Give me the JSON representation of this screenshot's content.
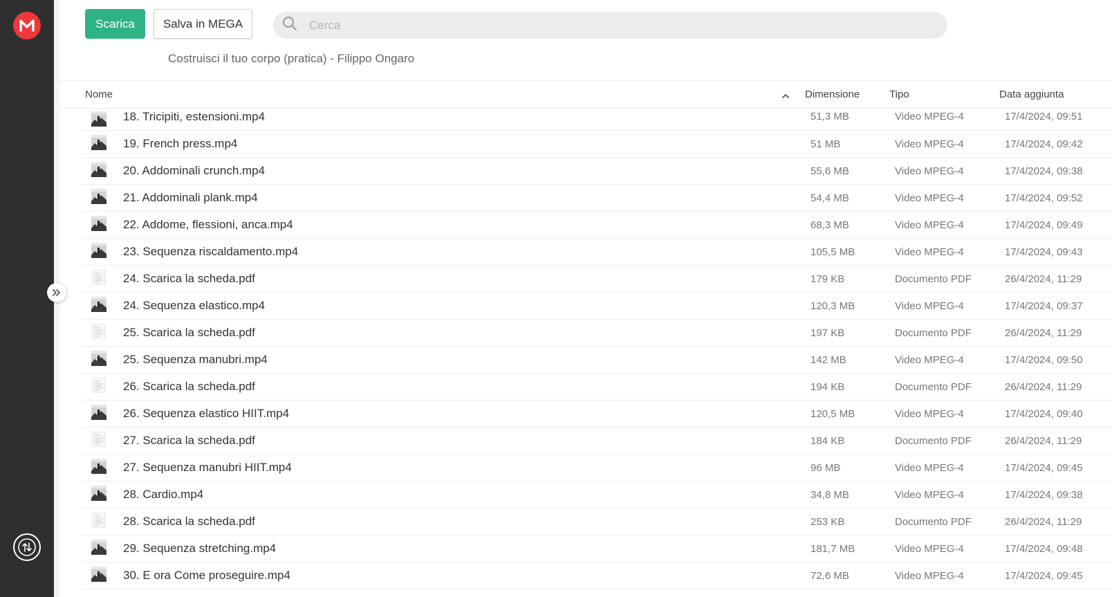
{
  "toolbar": {
    "download_label": "Scarica",
    "save_label": "Salva in MEGA"
  },
  "search": {
    "placeholder": "Cerca"
  },
  "folder_title": "Costruisci il tuo corpo (pratica) - Filippo Ongaro",
  "columns": {
    "name": "Nome",
    "size": "Dimensione",
    "type": "Tipo",
    "date": "Data aggiunta"
  },
  "files": [
    {
      "name": "18. Tricipiti, estensioni.mp4",
      "size": "51,3 MB",
      "type": "Video MPEG-4",
      "date": "17/4/2024, 09:51",
      "icon": "video-thumbnail"
    },
    {
      "name": "19. French press.mp4",
      "size": "51 MB",
      "type": "Video MPEG-4",
      "date": "17/4/2024, 09:42",
      "icon": "video-thumbnail"
    },
    {
      "name": "20. Addominali crunch.mp4",
      "size": "55,6 MB",
      "type": "Video MPEG-4",
      "date": "17/4/2024, 09:38",
      "icon": "video-thumbnail"
    },
    {
      "name": "21. Addominali plank.mp4",
      "size": "54,4 MB",
      "type": "Video MPEG-4",
      "date": "17/4/2024, 09:52",
      "icon": "video-thumbnail"
    },
    {
      "name": "22. Addome, flessioni, anca.mp4",
      "size": "68,3 MB",
      "type": "Video MPEG-4",
      "date": "17/4/2024, 09:49",
      "icon": "video-thumbnail"
    },
    {
      "name": "23. Sequenza riscaldamento.mp4",
      "size": "105,5 MB",
      "type": "Video MPEG-4",
      "date": "17/4/2024, 09:43",
      "icon": "video-thumbnail"
    },
    {
      "name": "24. Scarica la scheda.pdf",
      "size": "179 KB",
      "type": "Documento PDF",
      "date": "26/4/2024, 11:29",
      "icon": "pdf-thumbnail"
    },
    {
      "name": "24. Sequenza elastico.mp4",
      "size": "120,3 MB",
      "type": "Video MPEG-4",
      "date": "17/4/2024, 09:37",
      "icon": "video-thumbnail"
    },
    {
      "name": "25. Scarica la scheda.pdf",
      "size": "197 KB",
      "type": "Documento PDF",
      "date": "26/4/2024, 11:29",
      "icon": "pdf-thumbnail"
    },
    {
      "name": "25. Sequenza manubri.mp4",
      "size": "142 MB",
      "type": "Video MPEG-4",
      "date": "17/4/2024, 09:50",
      "icon": "video-thumbnail"
    },
    {
      "name": "26. Scarica la scheda.pdf",
      "size": "194 KB",
      "type": "Documento PDF",
      "date": "26/4/2024, 11:29",
      "icon": "pdf-thumbnail"
    },
    {
      "name": "26. Sequenza elastico HIIT.mp4",
      "size": "120,5 MB",
      "type": "Video MPEG-4",
      "date": "17/4/2024, 09:40",
      "icon": "video-thumbnail"
    },
    {
      "name": "27. Scarica la scheda.pdf",
      "size": "184 KB",
      "type": "Documento PDF",
      "date": "26/4/2024, 11:29",
      "icon": "pdf-thumbnail"
    },
    {
      "name": "27. Sequenza manubri HIIT.mp4",
      "size": "96 MB",
      "type": "Video MPEG-4",
      "date": "17/4/2024, 09:45",
      "icon": "video-thumbnail"
    },
    {
      "name": "28. Cardio.mp4",
      "size": "34,8 MB",
      "type": "Video MPEG-4",
      "date": "17/4/2024, 09:38",
      "icon": "video-thumbnail"
    },
    {
      "name": "28. Scarica la scheda.pdf",
      "size": "253 KB",
      "type": "Documento PDF",
      "date": "26/4/2024, 11:29",
      "icon": "pdf-thumbnail"
    },
    {
      "name": "29. Sequenza stretching.mp4",
      "size": "181,7 MB",
      "type": "Video MPEG-4",
      "date": "17/4/2024, 09:48",
      "icon": "video-thumbnail"
    },
    {
      "name": "30. E ora Come proseguire.mp4",
      "size": "72,6 MB",
      "type": "Video MPEG-4",
      "date": "17/4/2024, 09:45",
      "icon": "video-thumbnail"
    }
  ],
  "colors": {
    "sidebar": "#2f2f2f",
    "brand_red": "#f0373a",
    "primary_green": "#2fb287",
    "search_bg": "#ececec"
  },
  "icons": {
    "logo": "mega-logo-icon",
    "sidebar_toggle": "double-chevron-right-icon",
    "transfers": "transfer-arrows-icon",
    "search": "search-icon",
    "sort": "chevron-up-icon"
  }
}
